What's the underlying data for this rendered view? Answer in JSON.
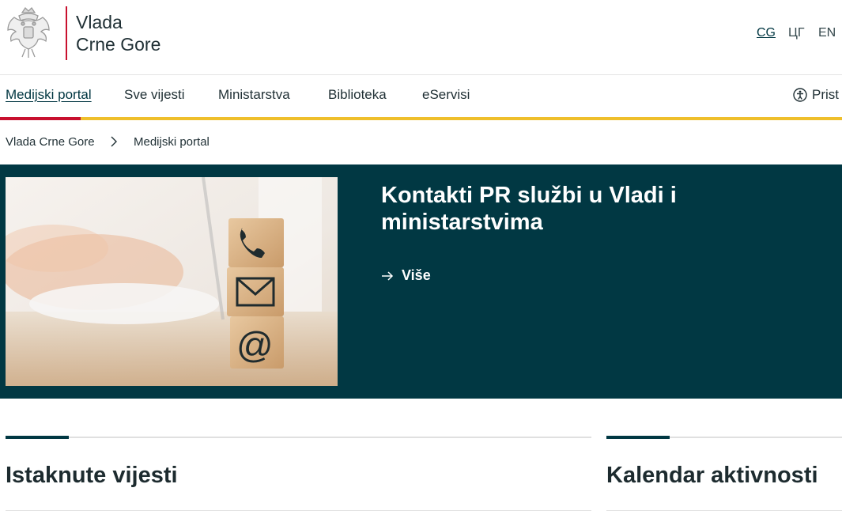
{
  "header": {
    "brand_line1": "Vlada",
    "brand_line2": "Crne Gore",
    "languages": [
      "CG",
      "ЦГ",
      "EN"
    ],
    "active_language": "CG"
  },
  "nav": {
    "items": [
      "Medijski portal",
      "Sve vijesti",
      "Ministarstva",
      "Biblioteka",
      "eServisi"
    ],
    "accessibility_label": "Prist"
  },
  "breadcrumb": {
    "items": [
      "Vlada Crne Gore",
      "Medijski portal"
    ]
  },
  "hero": {
    "title": "Kontakti PR službi u Vladi i ministarstvima",
    "more_label": "Više",
    "image_icons": [
      "phone-icon",
      "mail-icon",
      "at-icon"
    ]
  },
  "sections": {
    "featured_title": "Istaknute vijesti",
    "calendar_title": "Kalendar aktivnosti"
  },
  "colors": {
    "primary": "#013843",
    "accent_red": "#c8102e",
    "accent_yellow": "#efbf2b"
  }
}
